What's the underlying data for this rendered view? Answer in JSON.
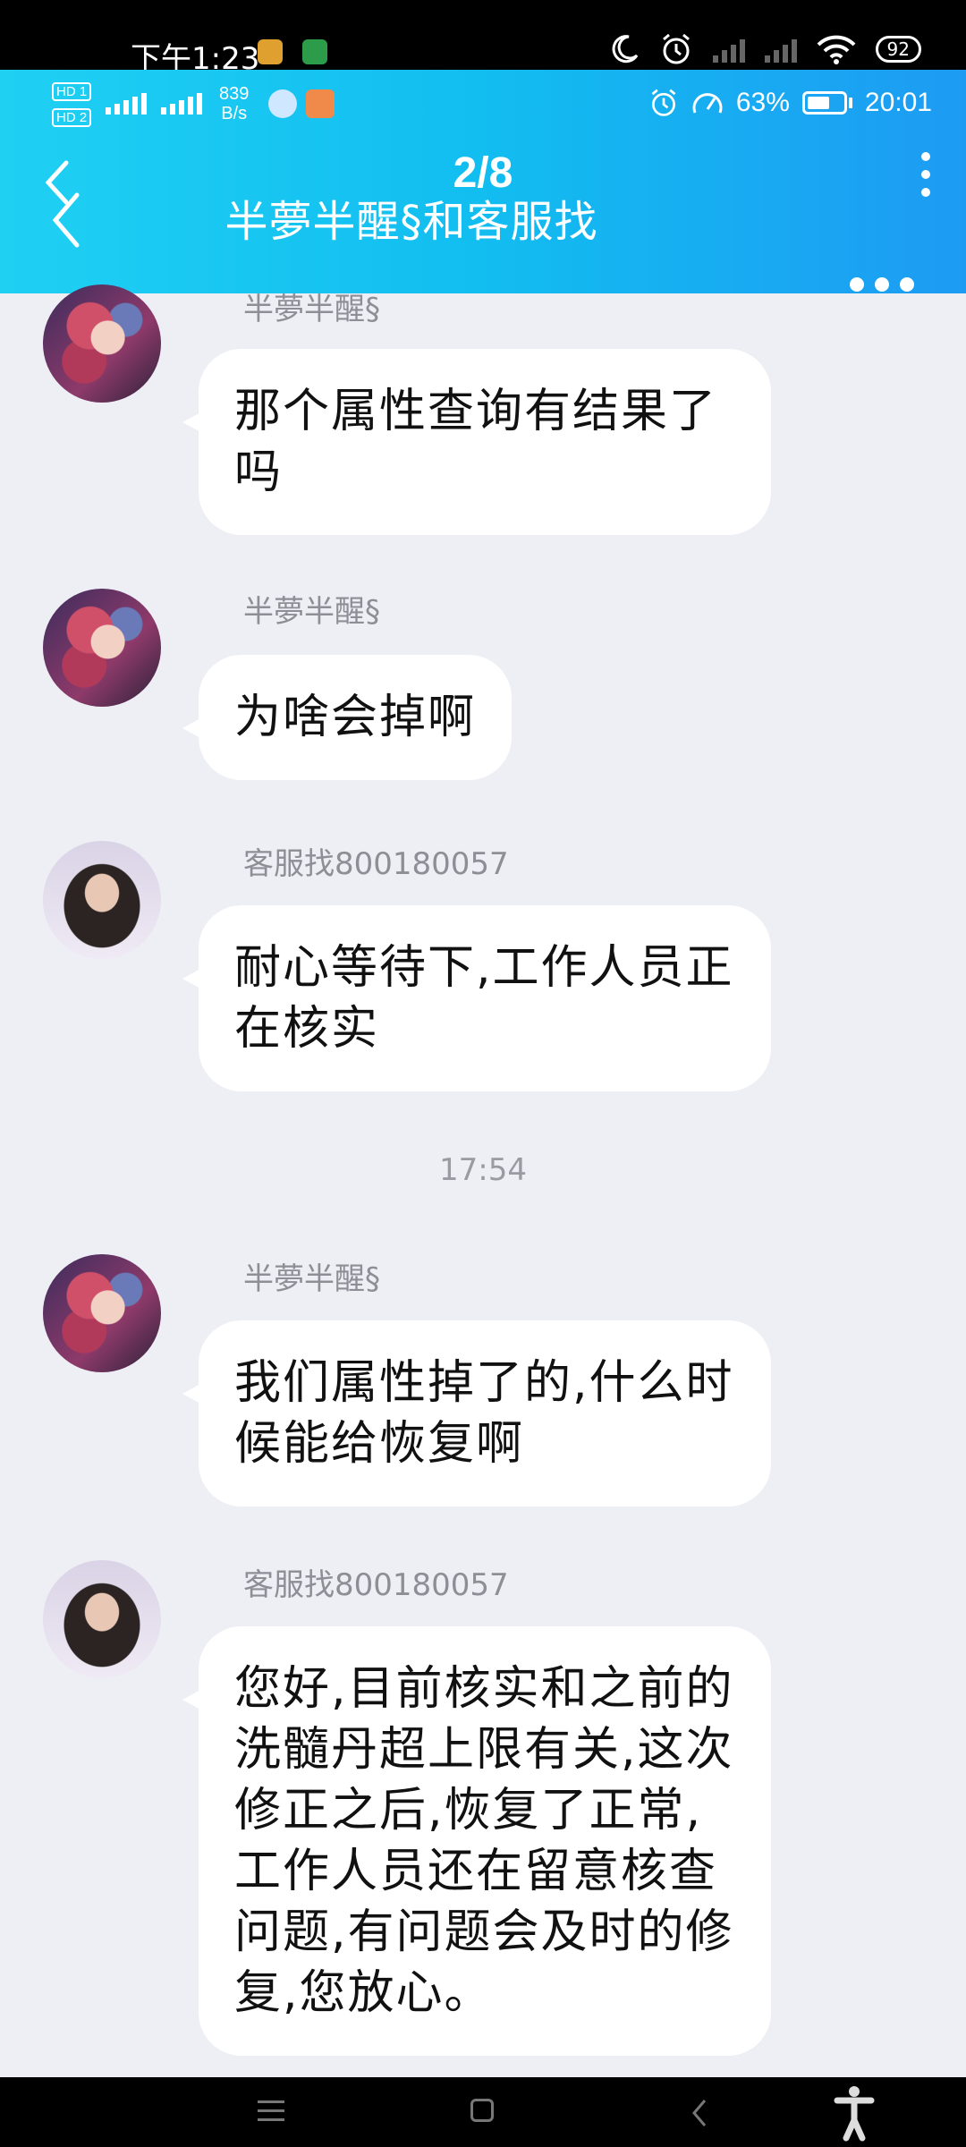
{
  "outer_status": {
    "time": "下午1:23",
    "battery": "92"
  },
  "inner_status": {
    "hd1": "HD 1",
    "hd2": "HD 2",
    "net_speed_value": "839",
    "net_speed_unit": "B/s",
    "speed_percent": "63%",
    "time": "20:01"
  },
  "viewer": {
    "page_indicator": "2/8"
  },
  "chat": {
    "title": "半夢半醒§和客服找",
    "timestamp": "17:54",
    "messages": [
      {
        "sender": "半夢半醒§",
        "text": "那个属性查询有结果了吗"
      },
      {
        "sender": "半夢半醒§",
        "text": "为啥会掉啊"
      },
      {
        "sender": "客服找800180057",
        "text": "耐心等待下,工作人员正在核实"
      },
      {
        "sender": "半夢半醒§",
        "text": "我们属性掉了的,什么时候能给恢复啊"
      },
      {
        "sender": "客服找800180057",
        "text": "您好,目前核实和之前的洗髓丹超上限有关,这次修正之后,恢复了正常,工作人员还在留意核查问题,有问题会及时的修复,您放心。"
      }
    ]
  },
  "icons": {
    "outer": [
      "moon-icon",
      "alarm-icon",
      "signal-icon",
      "wifi-icon",
      "battery-icon"
    ],
    "inner": [
      "alarm-icon",
      "speed-icon",
      "battery-icon"
    ],
    "nav": [
      "menu-icon",
      "home-icon",
      "back-icon",
      "accessibility-icon"
    ]
  },
  "colors": {
    "header_start": "#1fd0f3",
    "header_end": "#1d9bf3",
    "chat_bg": "#eeeef5",
    "bubble": "#ffffff"
  }
}
